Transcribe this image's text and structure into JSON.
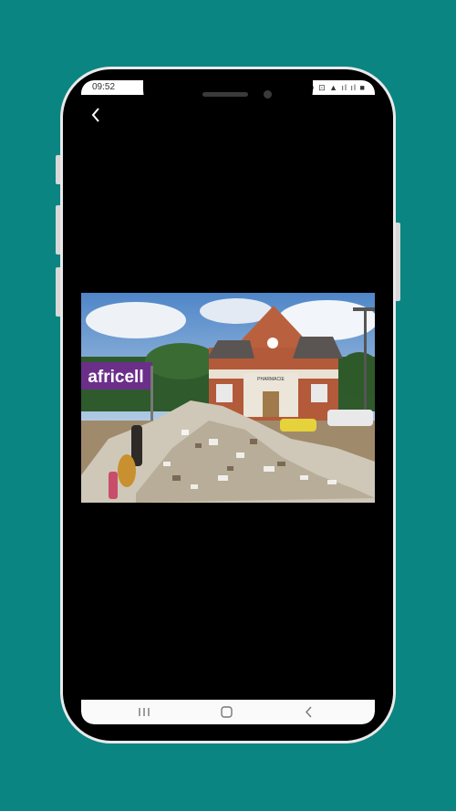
{
  "status_bar": {
    "time": "09:52",
    "icons_text": "⊕ ⊡  ▲ ıl ıl ■"
  },
  "toolbar": {
    "back_icon": "chevron-left-icon"
  },
  "photo": {
    "billboard_text": "africell",
    "building_sign": "PHARMACIE"
  },
  "nav_bar": {
    "recents_icon": "recents-icon",
    "home_icon": "home-icon",
    "back_icon": "back-icon"
  },
  "colors": {
    "background": "#0b8582",
    "billboard": "#6b2f8a"
  }
}
